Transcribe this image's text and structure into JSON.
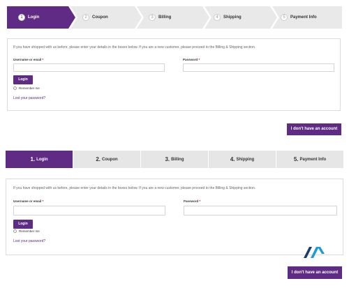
{
  "chevron_steps": [
    {
      "num": "1",
      "label": "Login",
      "active": true
    },
    {
      "num": "2",
      "label": "Coupon",
      "active": false
    },
    {
      "num": "3",
      "label": "Billing",
      "active": false
    },
    {
      "num": "4",
      "label": "Shipping",
      "active": false
    },
    {
      "num": "5",
      "label": "Payment Info",
      "active": false
    }
  ],
  "form_top": {
    "intro": "If you have shopped with us before, please enter your details in the boxes below. If you are a new customer, please proceed to the Billing & Shipping section.",
    "username_label": "Username or email",
    "password_label": "Password",
    "required_mark": "*",
    "username_value": "",
    "password_value": "",
    "login_label": "Login",
    "remember_label": "Remember me",
    "lost_password": "Lost your password?"
  },
  "no_account_top": "I don't have an account",
  "tabs": [
    {
      "num": "1.",
      "label": "Login",
      "active": true
    },
    {
      "num": "2.",
      "label": "Coupon",
      "active": false
    },
    {
      "num": "3.",
      "label": "Billing",
      "active": false
    },
    {
      "num": "4.",
      "label": "Shipping",
      "active": false
    },
    {
      "num": "5.",
      "label": "Payment Info",
      "active": false
    }
  ],
  "form_bottom": {
    "intro": "If you have shopped with us before, please enter your details in the boxes below. If you are a new customer, please proceed to the Billing & Shipping section.",
    "username_label": "Username or email",
    "password_label": "Password",
    "required_mark": "*",
    "username_value": "",
    "password_value": "",
    "login_label": "Login",
    "remember_label": "Remember me",
    "lost_password": "Lost your password?"
  },
  "no_account_bottom": "I don't have an account",
  "colors": {
    "accent": "#5f2b84",
    "inactive_tab": "#e6e6e6",
    "logo_dark": "#1d3a6b",
    "logo_light": "#1e9bd7"
  },
  "icons": {
    "logo": "brand-logo-icon",
    "checkbox": "radio-checkbox-icon"
  }
}
